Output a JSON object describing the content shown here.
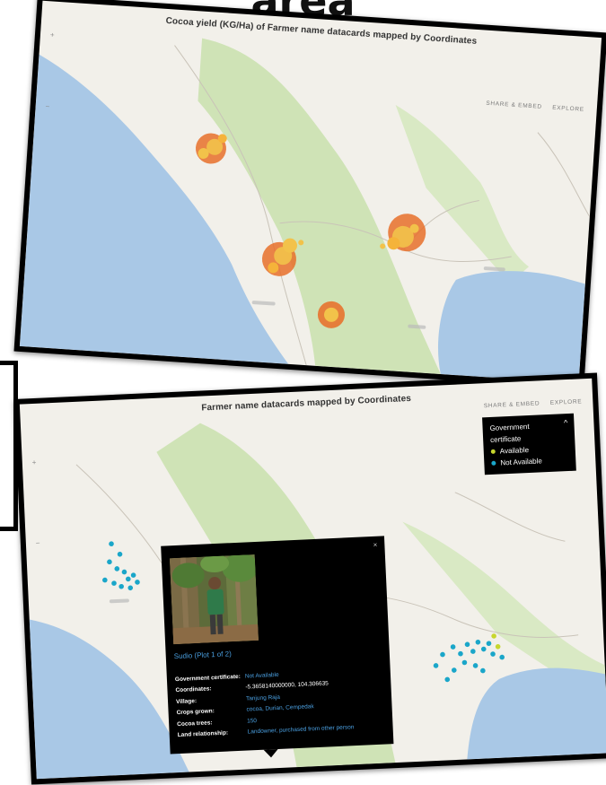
{
  "heading": "area",
  "map1": {
    "title": "Cocoa yield (KG/Ha) of Farmer name datacards mapped by Coordinates",
    "zoom_in": "+",
    "zoom_out": "−",
    "share_label": "SHARE & EMBED",
    "explore_label": "EXPLORE"
  },
  "map2": {
    "title": "Farmer name datacards mapped by Coordinates",
    "zoom_in": "+",
    "zoom_out": "−",
    "share_label": "SHARE & EMBED",
    "explore_label": "EXPLORE",
    "legend": {
      "title_line1": "Government",
      "title_line2": "certificate",
      "collapse_icon": "^",
      "items": [
        {
          "label": "Available",
          "color": "#c7d62e"
        },
        {
          "label": "Not Available",
          "color": "#1aa6c9"
        }
      ]
    },
    "popup": {
      "close": "×",
      "caption": "Sudio (Plot 1 of 2)",
      "rows": [
        {
          "key": "Government certificate:",
          "value": "Not Available"
        },
        {
          "key": "Coordinates:",
          "value": "-5.3658140000000, 104.306635"
        },
        {
          "key": "Village:",
          "value": "Tanjung Raja"
        },
        {
          "key": "Crops grown:",
          "value": "cocoa, Durian, Cempedak"
        },
        {
          "key": "Cocoa trees:",
          "value": "150"
        },
        {
          "key": "Land relationship:",
          "value": "Landowner, purchased from other person"
        }
      ]
    }
  },
  "colors": {
    "water": "#a9c8e6",
    "land": "#f2f0ea",
    "forest": "#cfe3b6",
    "bubble": "#e8702a",
    "bubble_inner": "#f2c24a",
    "point": "#1aa6c9",
    "point_available": "#c7d62e"
  }
}
